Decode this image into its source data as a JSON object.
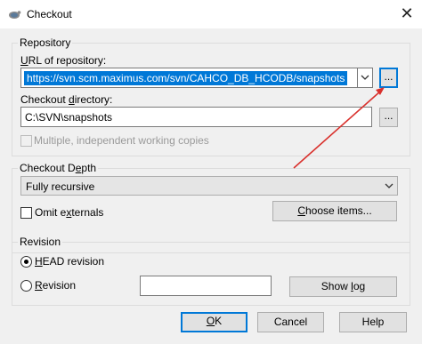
{
  "window": {
    "title": "Checkout",
    "close_glyph": "✕"
  },
  "repository": {
    "legend": "Repository",
    "url_label_prefix": "",
    "url_label_u": "U",
    "url_label_rest": "RL of repository:",
    "url_value": "https://svn.scm.maximus.com/svn/CAHCO_DB_HCODB/snapshots",
    "url_browse_label": "...",
    "dir_label_prefix": "Checkout ",
    "dir_label_u": "d",
    "dir_label_rest": "irectory:",
    "dir_value": "C:\\SVN\\snapshots",
    "dir_browse_label": "...",
    "multiple_wc_label": "Multiple, independent working copies",
    "multiple_wc_checked": false
  },
  "depth": {
    "legend_prefix": "Checkout D",
    "legend_u": "e",
    "legend_rest": "pth",
    "selected": "Fully recursive",
    "omit_externals_prefix": "Omit e",
    "omit_externals_u": "x",
    "omit_externals_rest": "ternals",
    "omit_externals_checked": false,
    "choose_items_prefix": "",
    "choose_items_u": "C",
    "choose_items_rest": "hoose items..."
  },
  "revision": {
    "legend": "Revision",
    "head_u": "H",
    "head_rest": "EAD revision",
    "head_selected": true,
    "rev_u": "R",
    "rev_rest": "evision",
    "rev_value": "",
    "show_log_prefix": "Show ",
    "show_log_u": "l",
    "show_log_rest": "og"
  },
  "buttons": {
    "ok_u": "O",
    "ok_rest": "K",
    "cancel": "Cancel",
    "help": "Help"
  },
  "colors": {
    "selection": "#0078d7",
    "annotation_arrow": "#d9302c"
  }
}
